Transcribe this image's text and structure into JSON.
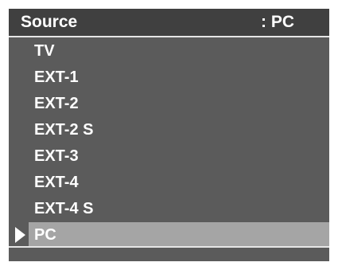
{
  "header": {
    "title": "Source",
    "value": ": PC"
  },
  "menu": {
    "items": [
      {
        "label": "TV"
      },
      {
        "label": "EXT-1"
      },
      {
        "label": "EXT-2"
      },
      {
        "label": "EXT-2 S"
      },
      {
        "label": "EXT-3"
      },
      {
        "label": "EXT-4"
      },
      {
        "label": "EXT-4 S"
      },
      {
        "label": "PC"
      }
    ],
    "selected_label": "PC"
  },
  "colors": {
    "panel": "#5b5b5b",
    "header": "#404040",
    "highlight": "#a5a5a5",
    "text": "#ffffff"
  }
}
